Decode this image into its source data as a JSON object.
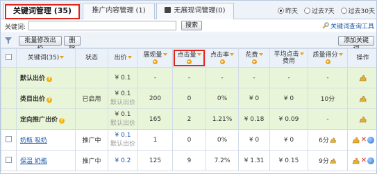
{
  "tabs": [
    {
      "label": "关键词管理 (35)"
    },
    {
      "label": "推广内容管理 (1)"
    },
    {
      "label": "无展现词管理(0)"
    }
  ],
  "period": {
    "options": [
      "昨天",
      "过去7天",
      "过去30天"
    ],
    "selected": "昨天"
  },
  "search": {
    "label": "关键词:",
    "value": "",
    "button": "搜索",
    "tool_link": "关键词查询工具"
  },
  "toolbar": {
    "batch_bid_label": "批量修改出价",
    "delete_label": "删除",
    "add_keyword_label": "添加关键词"
  },
  "columns": {
    "keyword": "关键词(35)",
    "status": "状态",
    "bid": "出价",
    "impressions": "展现量",
    "clicks": "点击量",
    "ctr": "点击率",
    "cost": "花费",
    "avg_cpc_line1": "平均点击",
    "avg_cpc_line2": "费用",
    "quality": "质量得分",
    "action": "操作"
  },
  "default_rows": [
    {
      "name": "默认出价",
      "status": "",
      "bid": "¥ 0.1",
      "bid_note": "",
      "impressions": "-",
      "clicks": "-",
      "ctr": "-",
      "cost": "-",
      "avg_cpc": "-",
      "quality": "-"
    },
    {
      "name": "类目出价",
      "status": "已启用",
      "bid": "¥ 0.1",
      "bid_note": "默认出价",
      "impressions": "200",
      "clicks": "0",
      "ctr": "0%",
      "cost": "¥ 0",
      "avg_cpc": "¥ 0",
      "quality": "10分"
    },
    {
      "name": "定向推广出价",
      "status": "",
      "bid": "¥ 0.1",
      "bid_note": "默认出价",
      "impressions": "165",
      "clicks": "2",
      "ctr": "1.21%",
      "cost": "¥ 0.18",
      "avg_cpc": "¥ 0.09",
      "quality": "-"
    }
  ],
  "keyword_rows": [
    {
      "name": "奶瓶 吸奶",
      "status": "推广中",
      "bid": "¥ 0.1",
      "bid_note": "默认出价",
      "impressions": "1",
      "clicks": "0",
      "ctr": "0%",
      "cost": "¥ 0",
      "avg_cpc": "¥ 0",
      "quality": "6分"
    },
    {
      "name": "保温 奶瓶",
      "status": "推广中",
      "bid": "¥ 0.2",
      "bid_note": "",
      "impressions": "125",
      "clicks": "9",
      "ctr": "7.2%",
      "cost": "¥ 1.31",
      "avg_cpc": "¥ 0.15",
      "quality": "9分"
    }
  ]
}
